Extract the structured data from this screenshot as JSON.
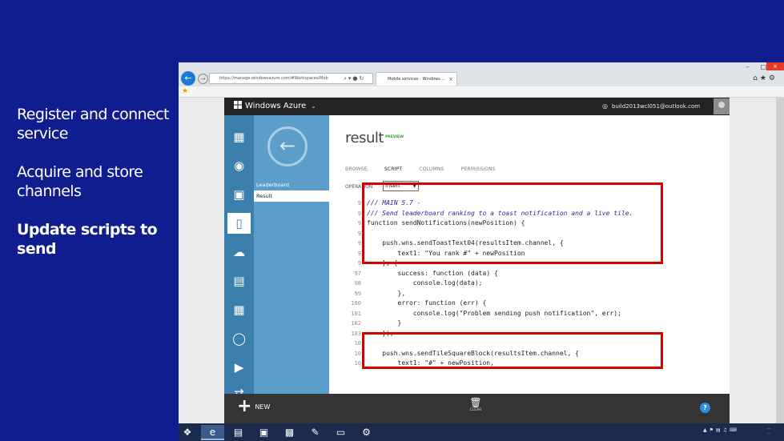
{
  "slide": {
    "bullets": [
      {
        "text": "Register and connect service",
        "bold": false
      },
      {
        "text": "Acquire and store channels",
        "bold": false
      },
      {
        "text": "Update scripts to send",
        "bold": true
      }
    ]
  },
  "browser": {
    "address": "https://manage.windowsazure.com/#Workspaces/Mob",
    "tab_title": "Mobile services - Windows ..."
  },
  "portal": {
    "brand": "Windows Azure",
    "account": "build2013wcl051@outlook.com",
    "nav_items": [
      "Leaderboard",
      "Result"
    ],
    "title": "result",
    "badge": "PREVIEW",
    "tabs": [
      "BROWSE",
      "SCRIPT",
      "COLUMNS",
      "PERMISSIONS"
    ],
    "operation_label": "OPERATION",
    "operation_value": "Insert",
    "new_label": "NEW",
    "clear_label": "CLEAR",
    "help_glyph": "?"
  },
  "code_lines": [
    {
      "n": "9",
      "text": "/// MAIN 5.7 -",
      "type": "cmt"
    },
    {
      "n": "9",
      "text": "/// Send leaderboard ranking to a toast notification and a live tile.",
      "type": "cmt"
    },
    {
      "n": "9",
      "text": "function sendNotifications(newPosition) {",
      "type": "code"
    },
    {
      "n": "9",
      "text": "",
      "type": "code"
    },
    {
      "n": "9",
      "text": "    push.wns.sendToastText04(resultsItem.channel, {",
      "type": "code"
    },
    {
      "n": "9",
      "text": "        text1: \"You rank #\" + newPosition",
      "type": "code"
    },
    {
      "n": "9",
      "text": "    }, {",
      "type": "code"
    },
    {
      "n": "97",
      "text": "        success: function (data) {",
      "type": "code"
    },
    {
      "n": "98",
      "text": "            console.log(data);",
      "type": "code"
    },
    {
      "n": "99",
      "text": "        },",
      "type": "code"
    },
    {
      "n": "100",
      "text": "        error: function (err) {",
      "type": "code"
    },
    {
      "n": "101",
      "text": "            console.log(\"Problem sending push notification\", err);",
      "type": "code"
    },
    {
      "n": "102",
      "text": "        }",
      "type": "code"
    },
    {
      "n": "103",
      "text": "    });",
      "type": "code"
    },
    {
      "n": "10",
      "text": "",
      "type": "code"
    },
    {
      "n": "10",
      "text": "    push.wns.sendTileSquareBlock(resultsItem.channel, {",
      "type": "code"
    },
    {
      "n": "10",
      "text": "        text1: \"#\" + newPosition,",
      "type": "code"
    }
  ]
}
